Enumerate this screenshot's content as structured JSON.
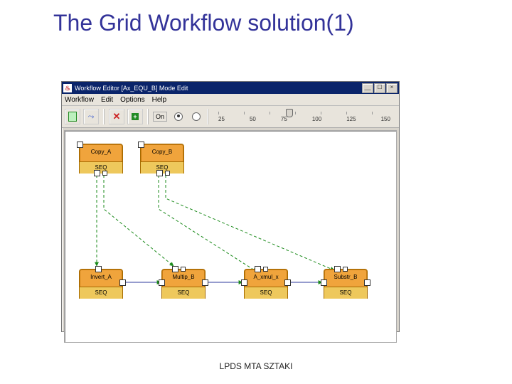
{
  "slide": {
    "title": "The Grid Workflow solution(1)",
    "footer": "LPDS MTA SZTAKI"
  },
  "window": {
    "title": "Workflow Editor   [Ax_EQU_B] Mode   Edit",
    "controls": {
      "min": "__",
      "max": "☐",
      "close": "×"
    }
  },
  "menu": {
    "workflow": "Workflow",
    "edit": "Edit",
    "options": "Options",
    "help": "Help"
  },
  "toolbar": {
    "toggle_on": "On",
    "ruler_ticks": [
      "25",
      "50",
      "75",
      "100",
      "125",
      "150"
    ]
  },
  "nodes": {
    "copy_a": {
      "name": "Copy_A",
      "seq": "SEQ"
    },
    "copy_b": {
      "name": "Copy_B",
      "seq": "SEQ"
    },
    "invert_a": {
      "name": "Invert_A",
      "seq": "SEQ"
    },
    "multip_b": {
      "name": "Multip_B",
      "seq": "SEQ"
    },
    "a_xmul_x": {
      "name": "A_xmul_x",
      "seq": "SEQ"
    },
    "substr_b": {
      "name": "Substr_B",
      "seq": "SEQ"
    }
  },
  "icons": {
    "java": "♨",
    "new_doc": "new-doc-icon",
    "connect": "connect-icon",
    "delete": "delete-icon",
    "add": "add-icon"
  }
}
